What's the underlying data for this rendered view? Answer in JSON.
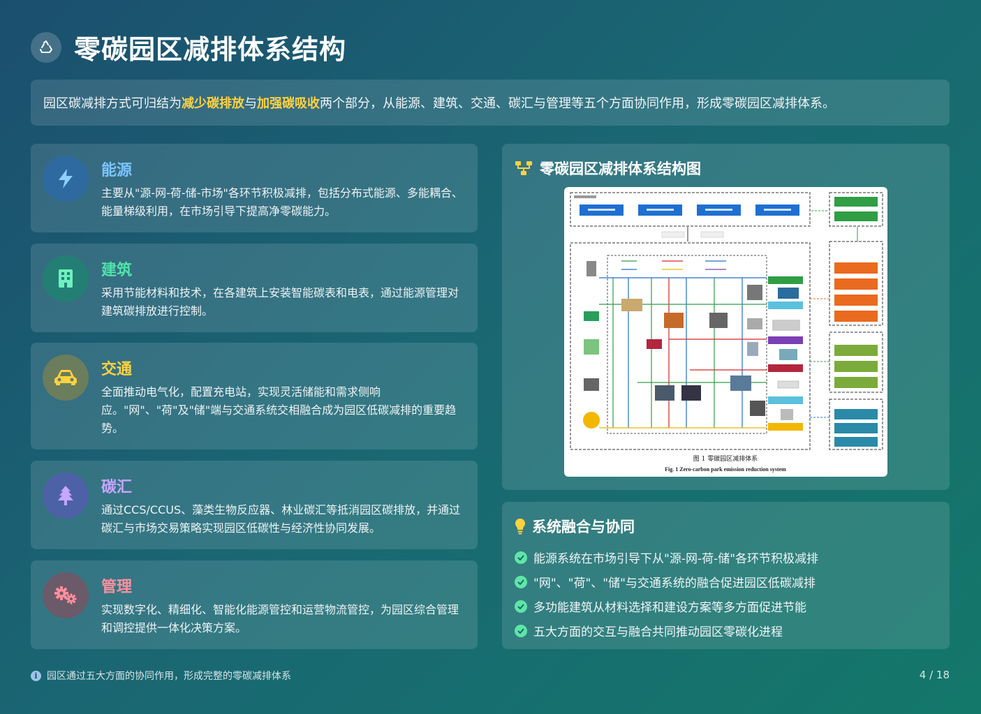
{
  "header": {
    "title": "零碳园区减排体系结构",
    "icon": "recycle-icon"
  },
  "intro": {
    "before": "园区碳减排方式可归结为",
    "highlight1": "减少碳排放",
    "mid": "与",
    "highlight2": "加强碳吸收",
    "after": "两个部分，从能源、建筑、交通、碳汇与管理等五个方面协同作用，形成零碳园区减排体系。",
    "highlight_color": "#ffd23f"
  },
  "cards": [
    {
      "title": "能源",
      "text": "主要从\"源-网-荷-储-市场\"各环节积极减排，包括分布式能源、多能耦合、能量梯级利用，在市场引导下提高净零碳能力。",
      "title_color": "#7cc4ff",
      "icon": "bolt-icon"
    },
    {
      "title": "建筑",
      "text": "采用节能材料和技术，在各建筑上安装智能碳表和电表，通过能源管理对建筑碳排放进行控制。",
      "title_color": "#4fe3a8",
      "icon": "building-icon"
    },
    {
      "title": "交通",
      "text": "全面推动电气化，配置充电站，实现灵活储能和需求侧响应。\"网\"、\"荷\"及\"储\"端与交通系统交相融合成为园区低碳减排的重要趋势。",
      "title_color": "#ffd23f",
      "icon": "car-icon"
    },
    {
      "title": "碳汇",
      "text": "通过CCS/CCUS、藻类生物反应器、林业碳汇等抵消园区碳排放，并通过碳汇与市场交易策略实现园区低碳性与经济性协同发展。",
      "title_color": "#c7a6ff",
      "icon": "tree-icon"
    },
    {
      "title": "管理",
      "text": "实现数字化、精细化、智能化能源管控和运营物流管控，为园区综合管理和调控提供一体化决策方案。",
      "title_color": "#ff8f9c",
      "icon": "gears-icon"
    }
  ],
  "diagram": {
    "title": "零碳园区减排体系结构图",
    "icon": "sitemap-icon",
    "figure": {
      "caption_cn": "图 1 零碳园区减排体系",
      "caption_en": "Fig. 1   Zero-carbon park emission reduction system"
    }
  },
  "synergy": {
    "title": "系统融合与协同",
    "icon": "lightbulb-icon",
    "items": [
      "能源系统在市场引导下从\"源-网-荷-储\"各环节积极减排",
      "\"网\"、\"荷\"、\"储\"与交通系统的融合促进园区低碳减排",
      "多功能建筑从材料选择和建设方案等多方面促进节能",
      "五大方面的交互与融合共同推动园区零碳化进程"
    ]
  },
  "footer": {
    "note": "园区通过五大方面的协同作用，形成完整的零碳减排体系",
    "page": "4 / 18"
  }
}
